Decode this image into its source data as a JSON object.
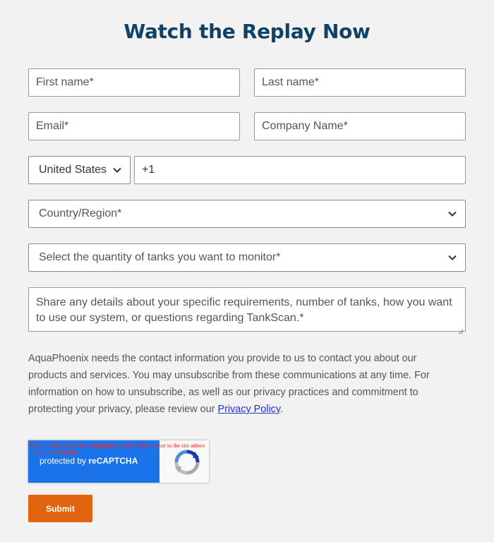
{
  "page": {
    "title": "Watch the Replay Now"
  },
  "form": {
    "first_name_placeholder": "First name*",
    "last_name_placeholder": "Last name*",
    "email_placeholder": "Email*",
    "company_placeholder": "Company Name*",
    "phone_country_selected": "United States",
    "phone_value": "+1",
    "country_region_selected": "Country/Region*",
    "tank_quantity_selected": "Select the quantity of tanks you want to monitor*",
    "details_placeholder": "Share any details about your specific requirements, number of tanks, how you want to use our system, or questions regarding TankScan.*",
    "submit_label": "Submit"
  },
  "disclaimer": {
    "text": "AquaPhoenix needs the contact information you provide to us to contact you about our products and services. You may unsubscribe from these communications at any time. For information on how to unsubscribe, as well as our privacy practices and commitment to protecting your privacy, please review our ",
    "link_label": "Privacy Policy",
    "suffix": "."
  },
  "recaptcha": {
    "warning": "This reCAPTCHA is for testing purposes only. Please report to the site admin if you are seeing this.",
    "protected_prefix": "protected by ",
    "brand": "reCAPTCHA"
  },
  "colors": {
    "title": "#0f4266",
    "submit_bg": "#e2640f",
    "recaptcha_blue": "#1a73e8",
    "link": "#2233cc",
    "background": "#f2f2f2"
  }
}
